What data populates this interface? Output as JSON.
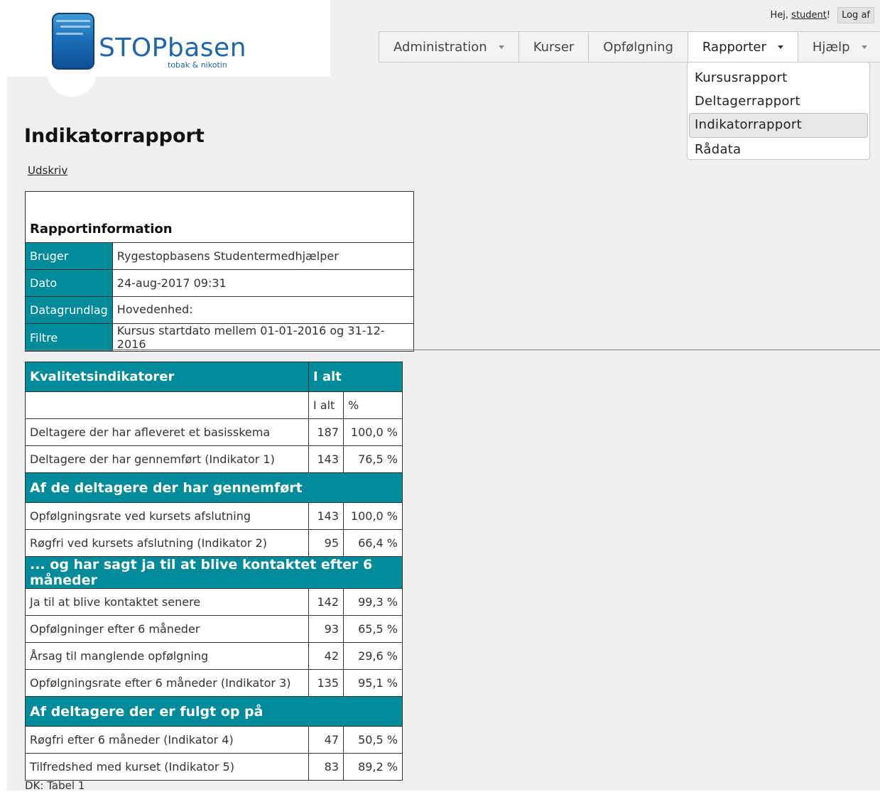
{
  "header": {
    "logo_text": "STOPbasen",
    "logo_sub": "tobak & nikotin",
    "greeting": "Hej,",
    "user": "student",
    "greeting_end": "!",
    "logout": "Log af"
  },
  "nav": {
    "administration": "Administration",
    "kurser": "Kurser",
    "opfolgning": "Opfølgning",
    "rapporter": "Rapporter",
    "hjaelp": "Hjælp"
  },
  "dropdown": {
    "items": [
      "Kursusrapport",
      "Deltagerrapport",
      "Indikatorrapport",
      "Rådata"
    ]
  },
  "page": {
    "title": "Indikatorrapport",
    "print": "Udskriv"
  },
  "report_info": {
    "title": "Rapportinformation",
    "rows": [
      {
        "label": "Bruger",
        "value": "Rygestopbasens Studentermedhjælper"
      },
      {
        "label": "Dato",
        "value": "24-aug-2017 09:31"
      },
      {
        "label": "Datagrundlag",
        "value": "Hovedenhed:"
      },
      {
        "label": "Filtre",
        "value": "Kursus startdato mellem 01-01-2016 og 31-12-2016"
      }
    ]
  },
  "kpi": {
    "header_left": "Kvalitetsindikatorer",
    "header_right": "I alt",
    "sub_total": "I alt",
    "sub_pct": "%",
    "rows_a": [
      {
        "label": "Deltagere der har afleveret et basisskema",
        "count": "187",
        "pct": "100,0 %"
      },
      {
        "label": "Deltagere der har gennemført (Indikator 1)",
        "count": "143",
        "pct": "76,5 %"
      }
    ],
    "section_b": "Af de deltagere der har gennemført",
    "rows_b": [
      {
        "label": "Opfølgningsrate ved kursets afslutning",
        "count": "143",
        "pct": "100,0 %"
      },
      {
        "label": "Røgfri ved kursets afslutning (Indikator 2)",
        "count": "95",
        "pct": "66,4 %"
      }
    ],
    "section_c": "... og har sagt ja til at blive kontaktet efter 6 måneder",
    "rows_c": [
      {
        "label": "Ja til at blive kontaktet senere",
        "count": "142",
        "pct": "99,3 %"
      },
      {
        "label": "Opfølgninger efter 6 måneder",
        "count": "93",
        "pct": "65,5 %"
      },
      {
        "label": "Årsag til manglende opfølgning",
        "count": "42",
        "pct": "29,6 %"
      },
      {
        "label": "Opfølgningsrate efter 6 måneder (Indikator 3)",
        "count": "135",
        "pct": "95,1 %"
      }
    ],
    "section_d": "Af deltagere der er fulgt op på",
    "rows_d": [
      {
        "label": "Røgfri efter 6 måneder (Indikator 4)",
        "count": "47",
        "pct": "50,5 %"
      },
      {
        "label": "Tilfredshed med kurset (Indikator 5)",
        "count": "83",
        "pct": "89,2 %"
      }
    ],
    "caption": "DK: Tabel 1"
  }
}
